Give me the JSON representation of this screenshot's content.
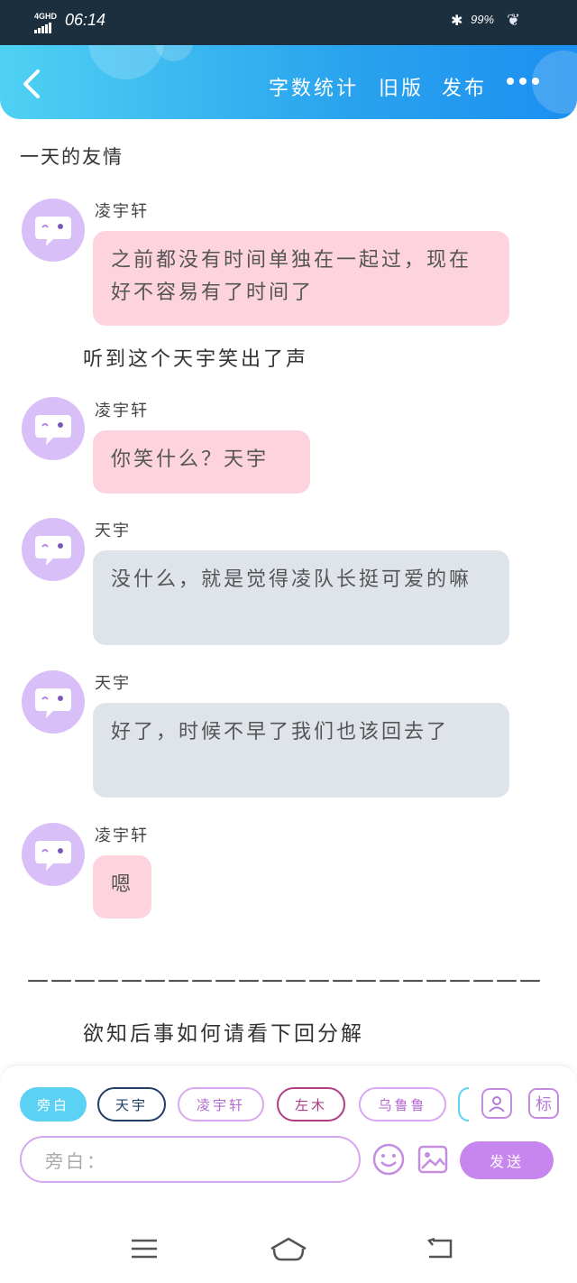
{
  "status_bar": {
    "network": "4GHD",
    "time": "06:14",
    "battery": "99%"
  },
  "nav": {
    "word_count": "字数统计",
    "old_version": "旧版",
    "publish": "发布"
  },
  "story": {
    "title": "一天的友情",
    "messages": [
      {
        "speaker": "凌宇轩",
        "text": "之前都没有时间单独在一起过，现在好不容易有了时间了"
      },
      {
        "narration": "听到这个天宇笑出了声"
      },
      {
        "speaker": "凌宇轩",
        "text": "你笑什么？天宇"
      },
      {
        "speaker": "天宇",
        "text": "没什么，就是觉得凌队长挺可爱的嘛"
      },
      {
        "speaker": "天宇",
        "text": "好了，时候不早了我们也该回去了"
      },
      {
        "speaker": "凌宇轩",
        "text": "嗯"
      }
    ],
    "divider": "——————————————————————",
    "ending": "欲知后事如何请看下回分解"
  },
  "composer": {
    "roles": [
      "旁白",
      "天宇",
      "凌宇轩",
      "左木",
      "乌鲁鲁"
    ],
    "label_button": "标",
    "input_placeholder": "旁白：",
    "send_label": "发送"
  },
  "colors": {
    "accent": "#2aa3ee",
    "pink_bubble": "#fdd3de",
    "gray_bubble": "#dfe4eb",
    "avatar": "#d9bff7",
    "send": "#c686ee"
  }
}
